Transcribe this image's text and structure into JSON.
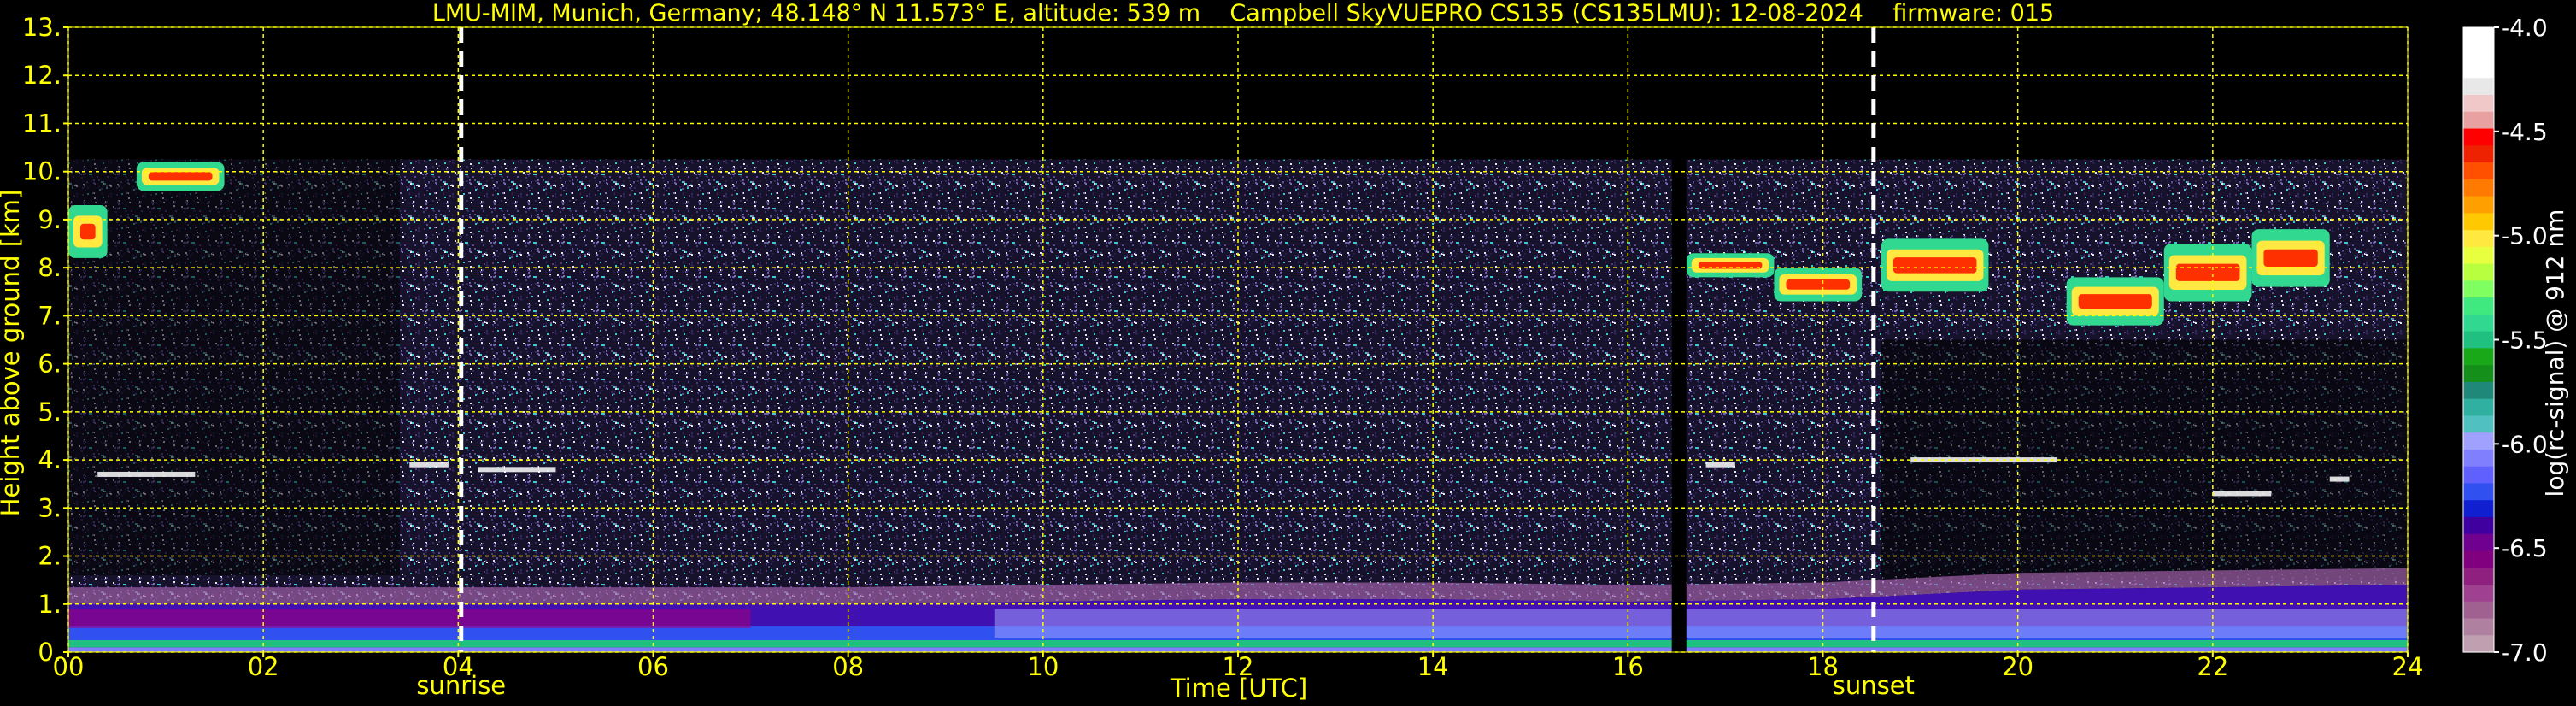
{
  "title": "LMU-MIM, Munich, Germany; 48.148° N 11.573° E, altitude: 539 m    Campbell SkyVUEPRO CS135 (CS135LMU): 12-08-2024    firmware: 015",
  "colors": {
    "axis_text": "#ffff00",
    "grid": "#ffff00",
    "background": "#000000",
    "markers": "#ffffff"
  },
  "chart_data": {
    "type": "heatmap",
    "title": "LMU-MIM, Munich, Germany; 48.148° N 11.573° E, altitude: 539 m    Campbell SkyVUEPRO CS135 (CS135LMU): 12-08-2024    firmware: 015",
    "xlabel": "Time [UTC]",
    "ylabel": "Height above ground [km]",
    "xlim": [
      0,
      24
    ],
    "ylim": [
      0,
      13
    ],
    "x_ticks": [
      0,
      2,
      4,
      6,
      8,
      10,
      12,
      14,
      16,
      18,
      20,
      22,
      24
    ],
    "x_tick_labels": [
      "00",
      "02",
      "04",
      "06",
      "08",
      "10",
      "12",
      "14",
      "16",
      "18",
      "20",
      "22",
      "24"
    ],
    "y_ticks": [
      0,
      1,
      2,
      3,
      4,
      5,
      6,
      7,
      8,
      9,
      10,
      11,
      12,
      13
    ],
    "y_tick_labels": [
      "0.",
      "1.",
      "2.",
      "3.",
      "4.",
      "5.",
      "6.",
      "7.",
      "8.",
      "9.",
      "10.",
      "11.",
      "12.",
      "13."
    ],
    "grid": true,
    "measurement_top_km": 10.25,
    "data_gap_hours": [
      16.45,
      16.6
    ],
    "events": [
      {
        "label": "sunrise",
        "time": 4.03
      },
      {
        "label": "sunset",
        "time": 18.52
      }
    ],
    "colorbar": {
      "label": "log(rc-signal) @ 912 nm",
      "range": [
        -7.0,
        -4.0
      ],
      "ticks": [
        -4.0,
        -4.5,
        -5.0,
        -5.5,
        -6.0,
        -6.5,
        -7.0
      ],
      "tick_labels": [
        "-4.0",
        "-4.5",
        "-5.0",
        "-5.5",
        "-6.0",
        "-6.5",
        "-7.0"
      ],
      "colors": [
        "#ffffff",
        "#ffffff",
        "#ffffff",
        "#e8e8e8",
        "#f0c8c8",
        "#e8a0a0",
        "#ff0000",
        "#ee2200",
        "#ff5000",
        "#ff7a00",
        "#ffa000",
        "#ffc800",
        "#ffe840",
        "#e8ff40",
        "#b8ff40",
        "#80ff60",
        "#40e880",
        "#30d890",
        "#20c080",
        "#18a818",
        "#14901a",
        "#208878",
        "#30b0a0",
        "#50c0c0",
        "#a0a0ff",
        "#8080ff",
        "#6060ff",
        "#3050f0",
        "#1020d0",
        "#4000a0",
        "#700090",
        "#800080",
        "#902080",
        "#a04090",
        "#a06090",
        "#b080a0",
        "#c0a0b0"
      ]
    },
    "aerosol_layer": [
      {
        "t": 0,
        "top": 1.0
      },
      {
        "t": 2,
        "top": 1.0
      },
      {
        "t": 4,
        "top": 1.0
      },
      {
        "t": 6,
        "top": 1.0
      },
      {
        "t": 8,
        "top": 1.0
      },
      {
        "t": 10,
        "top": 1.05
      },
      {
        "t": 12,
        "top": 1.1
      },
      {
        "t": 14,
        "top": 1.1
      },
      {
        "t": 16,
        "top": 1.05
      },
      {
        "t": 18,
        "top": 1.1
      },
      {
        "t": 20,
        "top": 1.3
      },
      {
        "t": 22,
        "top": 1.35
      },
      {
        "t": 24,
        "top": 1.4
      }
    ],
    "cirrus_segments": [
      {
        "t0": 0.0,
        "t1": 0.4,
        "h0": 8.2,
        "h1": 9.3
      },
      {
        "t0": 0.7,
        "t1": 1.6,
        "h0": 9.6,
        "h1": 10.2
      },
      {
        "t0": 16.6,
        "t1": 17.5,
        "h0": 7.8,
        "h1": 8.3
      },
      {
        "t0": 17.5,
        "t1": 18.4,
        "h0": 7.3,
        "h1": 8.0
      },
      {
        "t0": 18.6,
        "t1": 19.7,
        "h0": 7.5,
        "h1": 8.6
      },
      {
        "t0": 20.5,
        "t1": 21.5,
        "h0": 6.8,
        "h1": 7.8
      },
      {
        "t0": 21.5,
        "t1": 22.4,
        "h0": 7.3,
        "h1": 8.5
      },
      {
        "t0": 22.4,
        "t1": 23.2,
        "h0": 7.6,
        "h1": 8.8
      }
    ],
    "low_cloud_segments": [
      {
        "t0": 0.3,
        "t1": 1.3,
        "h": 3.7
      },
      {
        "t0": 3.5,
        "t1": 3.9,
        "h": 3.9
      },
      {
        "t0": 4.2,
        "t1": 5.0,
        "h": 3.8
      },
      {
        "t0": 16.8,
        "t1": 17.1,
        "h": 3.9
      },
      {
        "t0": 18.9,
        "t1": 20.4,
        "h": 4.0
      },
      {
        "t0": 22.0,
        "t1": 22.6,
        "h": 3.3
      },
      {
        "t0": 23.2,
        "t1": 23.4,
        "h": 3.6
      }
    ]
  }
}
